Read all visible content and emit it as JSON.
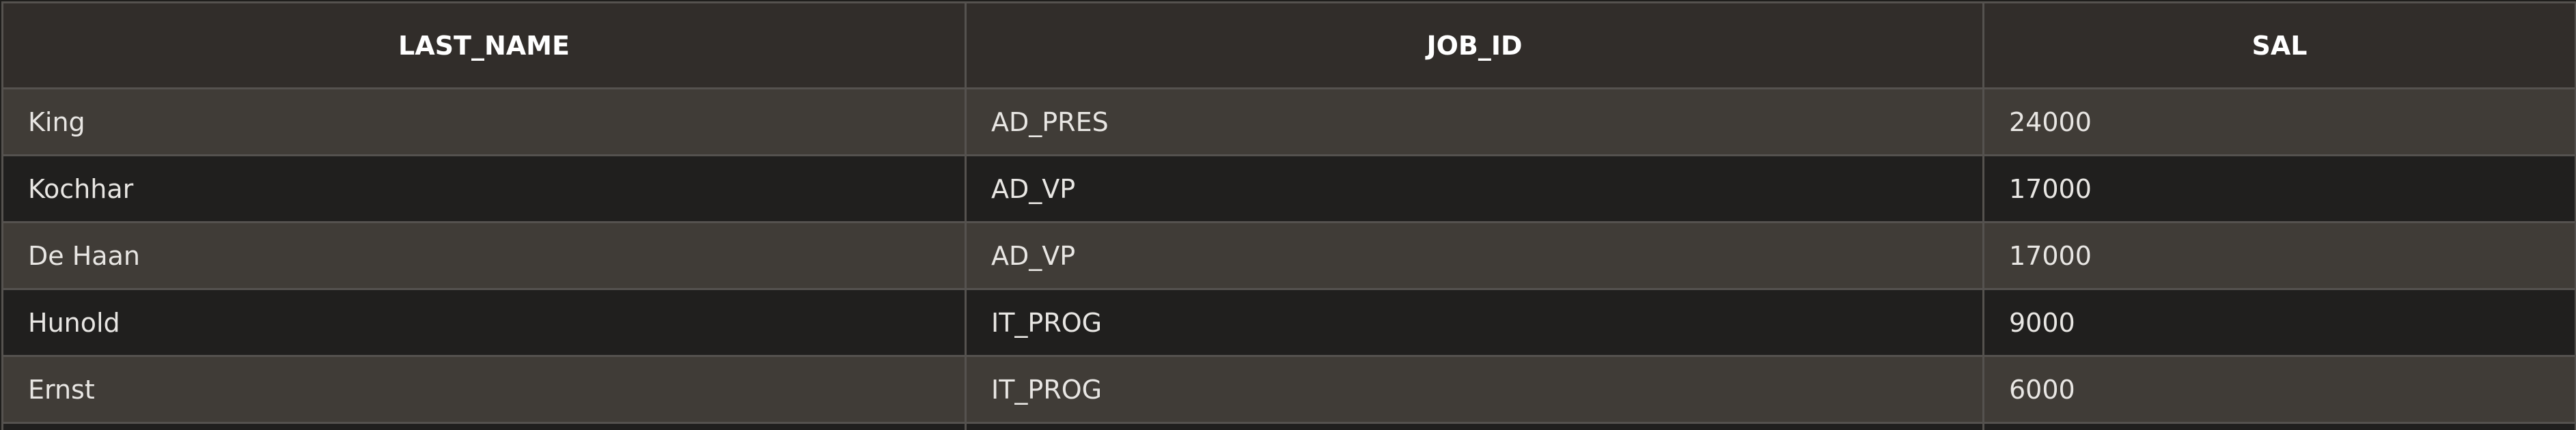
{
  "grid": {
    "columns": [
      "LAST_NAME",
      "JOB_ID",
      "SAL"
    ],
    "rows": [
      [
        "King",
        "AD_PRES",
        "24000"
      ],
      [
        "Kochhar",
        "AD_VP",
        "17000"
      ],
      [
        "De Haan",
        "AD_VP",
        "17000"
      ],
      [
        "Hunold",
        "IT_PROG",
        "9000"
      ],
      [
        "Ernst",
        "IT_PROG",
        "6000"
      ]
    ]
  },
  "colors": {
    "header_bg": "#312d2a",
    "row_odd_bg": "#403c37",
    "row_even_bg": "#201f1e",
    "border": "#55524f",
    "text": "#e8e6e3"
  }
}
